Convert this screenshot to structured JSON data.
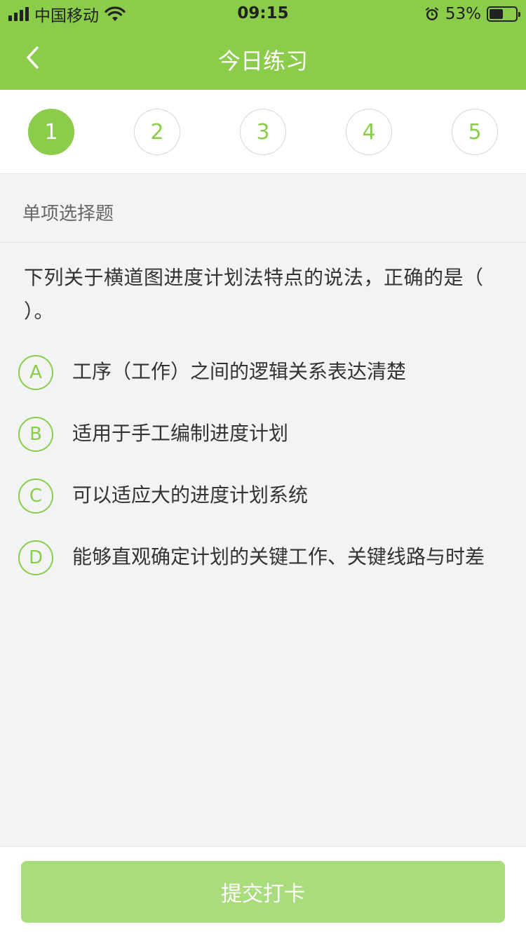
{
  "status_bar": {
    "carrier": "中国移动",
    "time": "09:15",
    "battery_percent": "53%",
    "battery_level": 0.53
  },
  "nav": {
    "title": "今日练习",
    "back_icon": "chevron-left-icon"
  },
  "steps": [
    {
      "label": "1",
      "active": true
    },
    {
      "label": "2",
      "active": false
    },
    {
      "label": "3",
      "active": false
    },
    {
      "label": "4",
      "active": false
    },
    {
      "label": "5",
      "active": false
    }
  ],
  "question": {
    "type": "单项选择题",
    "text": "下列关于横道图进度计划法特点的说法，正确的是（ ）。",
    "options": [
      {
        "letter": "A",
        "text": "工序（工作）之间的逻辑关系表达清楚"
      },
      {
        "letter": "B",
        "text": "适用于手工编制进度计划"
      },
      {
        "letter": "C",
        "text": "可以适应大的进度计划系统"
      },
      {
        "letter": "D",
        "text": "能够直观确定计划的关键工作、关键线路与时差"
      }
    ]
  },
  "footer": {
    "submit_label": "提交打卡"
  },
  "colors": {
    "accent": "#8bcc4b",
    "button_disabled": "#a9dd7b",
    "background": "#f2f3f5"
  }
}
